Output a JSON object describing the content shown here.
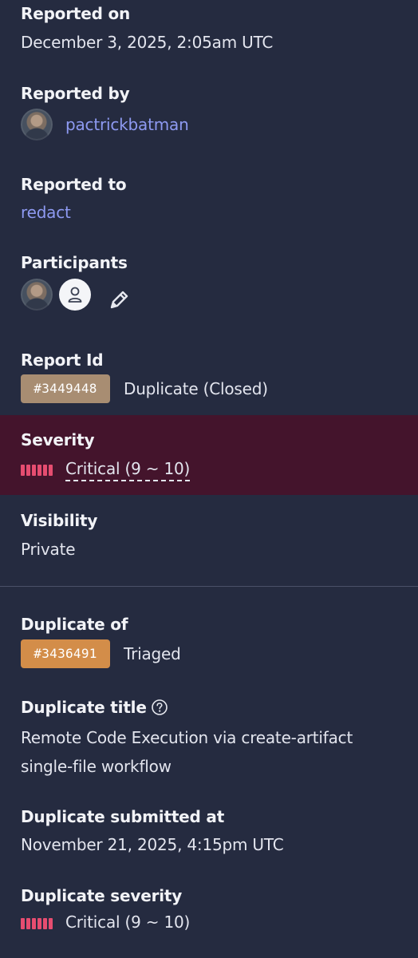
{
  "reported_on": {
    "label": "Reported on",
    "value": "December 3, 2025, 2:05am UTC"
  },
  "reported_by": {
    "label": "Reported by",
    "username": "pactrickbatman"
  },
  "reported_to": {
    "label": "Reported to",
    "value": "redact"
  },
  "participants": {
    "label": "Participants",
    "icons": [
      "avatar-photo",
      "user-placeholder-icon",
      "pencil-icon"
    ]
  },
  "report_id": {
    "label": "Report Id",
    "id": "#3449448",
    "status": "Duplicate (Closed)",
    "pill_color": "#a88d72"
  },
  "severity": {
    "label": "Severity",
    "value": "Critical (9 ~ 10)",
    "band_color": "#44142c",
    "bar_color": "#e64d70"
  },
  "visibility": {
    "label": "Visibility",
    "value": "Private"
  },
  "duplicate_of": {
    "label": "Duplicate of",
    "id": "#3436491",
    "status": "Triaged",
    "pill_color": "#d38d49"
  },
  "duplicate_title": {
    "label": "Duplicate title",
    "line1": "Remote Code Execution via create-artifact",
    "line2": "single-file workflow"
  },
  "duplicate_submitted": {
    "label": "Duplicate submitted at",
    "value": "November 21, 2025, 4:15pm UTC"
  },
  "duplicate_severity": {
    "label": "Duplicate severity",
    "value": "Critical (9 ~ 10)"
  },
  "colors": {
    "background": "#252b40",
    "link": "#8e9af2"
  }
}
